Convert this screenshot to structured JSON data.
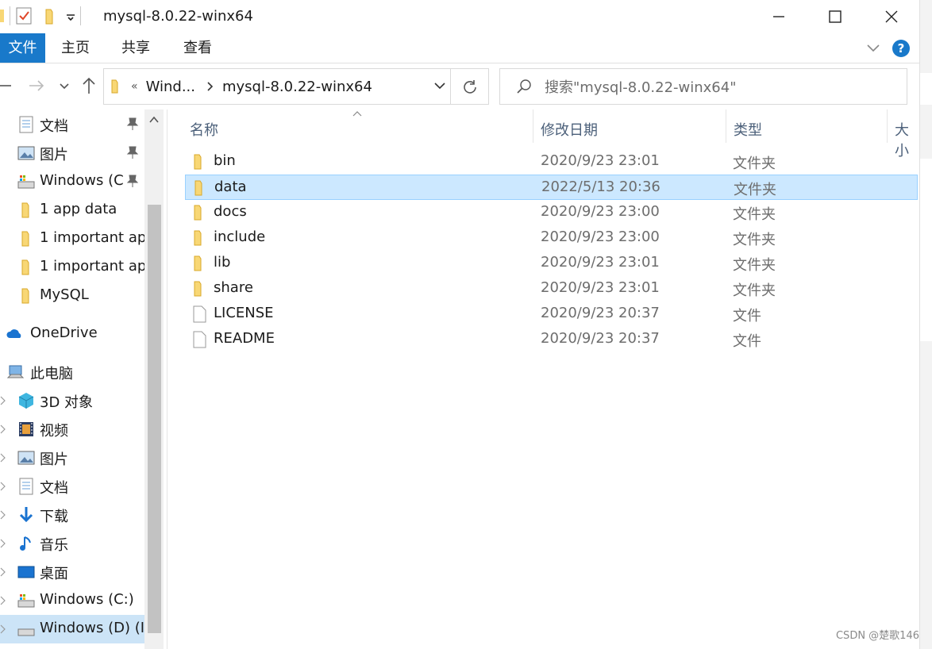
{
  "window": {
    "title": "mysql-8.0.22-winx64"
  },
  "ribbon": {
    "tabs": [
      {
        "label": "文件",
        "active": true
      },
      {
        "label": "主页"
      },
      {
        "label": "共享"
      },
      {
        "label": "查看"
      }
    ]
  },
  "address": {
    "root": "Wind...",
    "current": "mysql-8.0.22-winx64",
    "overflow_glyph": "«"
  },
  "search": {
    "placeholder": "搜索\"mysql-8.0.22-winx64\""
  },
  "sidebar": {
    "items": [
      {
        "label": "文档",
        "icon": "document-icon",
        "pinned": true
      },
      {
        "label": "图片",
        "icon": "pictures-icon",
        "pinned": true
      },
      {
        "label": "Windows  (C",
        "icon": "drive-icon",
        "pinned": true
      },
      {
        "label": "1 app data",
        "icon": "folder-icon"
      },
      {
        "label": "1 important ap",
        "icon": "folder-icon"
      },
      {
        "label": "1 important ap",
        "icon": "folder-icon"
      },
      {
        "label": "MySQL",
        "icon": "folder-icon"
      },
      {
        "label": "OneDrive",
        "icon": "onedrive-icon"
      },
      {
        "label": "此电脑",
        "icon": "computer-icon"
      },
      {
        "label": "3D 对象",
        "icon": "3d-objects-icon"
      },
      {
        "label": "视频",
        "icon": "videos-icon"
      },
      {
        "label": "图片",
        "icon": "pictures-icon"
      },
      {
        "label": "文档",
        "icon": "document-icon"
      },
      {
        "label": "下载",
        "icon": "downloads-icon"
      },
      {
        "label": "音乐",
        "icon": "music-icon"
      },
      {
        "label": "桌面",
        "icon": "desktop-icon"
      },
      {
        "label": "Windows  (C:)",
        "icon": "drive-icon"
      },
      {
        "label": "Windows  (D) (I",
        "icon": "drive-icon"
      }
    ]
  },
  "columns": {
    "name": "名称",
    "modified": "修改日期",
    "type": "类型",
    "size": "大小"
  },
  "files": [
    {
      "name": "bin",
      "date": "2020/9/23 23:01",
      "type": "文件夹",
      "kind": "folder"
    },
    {
      "name": "data",
      "date": "2022/5/13 20:36",
      "type": "文件夹",
      "kind": "folder",
      "selected": true
    },
    {
      "name": "docs",
      "date": "2020/9/23 23:00",
      "type": "文件夹",
      "kind": "folder"
    },
    {
      "name": "include",
      "date": "2020/9/23 23:00",
      "type": "文件夹",
      "kind": "folder"
    },
    {
      "name": "lib",
      "date": "2020/9/23 23:01",
      "type": "文件夹",
      "kind": "folder"
    },
    {
      "name": "share",
      "date": "2020/9/23 23:01",
      "type": "文件夹",
      "kind": "folder"
    },
    {
      "name": "LICENSE",
      "date": "2020/9/23 20:37",
      "type": "文件",
      "kind": "file"
    },
    {
      "name": "README",
      "date": "2020/9/23 20:37",
      "type": "文件",
      "kind": "file"
    }
  ],
  "watermark": "CSDN @楚歌146",
  "colors": {
    "accent": "#1979ca",
    "selection": "#cce8ff",
    "folder": "#f8d775"
  }
}
